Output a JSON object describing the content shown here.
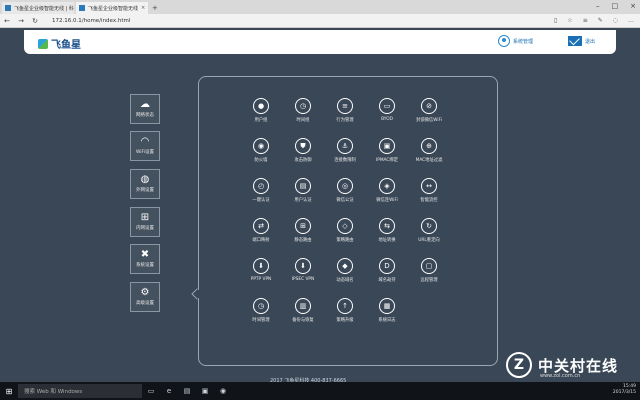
{
  "browser": {
    "tabs": [
      {
        "label": "飞鱼星企业级智能无线 | 科",
        "active": false
      },
      {
        "label": "飞鱼星企业级智能无线",
        "active": true
      }
    ],
    "url": "172.16.0.1/home/index.html"
  },
  "header": {
    "logo": "飞鱼星",
    "user_label": "系统管理",
    "logout_label": "退出"
  },
  "sidebar": [
    {
      "label": "网络状态",
      "icon": "cloud-icon"
    },
    {
      "label": "WiFi设置",
      "icon": "wifi-icon"
    },
    {
      "label": "外网设置",
      "icon": "globe-icon"
    },
    {
      "label": "内网设置",
      "icon": "network-icon"
    },
    {
      "label": "系统设置",
      "icon": "tools-icon"
    },
    {
      "label": "高级设置",
      "icon": "gears-icon"
    }
  ],
  "grid": [
    {
      "label": "用户组",
      "icon": "user-icon",
      "glyph": "●"
    },
    {
      "label": "时间组",
      "icon": "clock-icon",
      "glyph": "◷"
    },
    {
      "label": "行为管理",
      "icon": "toggle-icon",
      "glyph": "≡"
    },
    {
      "label": "BYOD",
      "icon": "devices-icon",
      "glyph": "▭"
    },
    {
      "label": "封锁微信WiFi",
      "icon": "block-icon",
      "glyph": "⊘"
    },
    {
      "label": "防火墙",
      "icon": "firewall-icon",
      "glyph": "◉"
    },
    {
      "label": "攻击防御",
      "icon": "shield-icon",
      "glyph": "⛊"
    },
    {
      "label": "连接数限制",
      "icon": "connections-icon",
      "glyph": "⚓"
    },
    {
      "label": "IPMAC绑定",
      "icon": "bind-icon",
      "glyph": "▣"
    },
    {
      "label": "MAC地址过滤",
      "icon": "filter-icon",
      "glyph": "⊕"
    },
    {
      "label": "一键认证",
      "icon": "auth-icon",
      "glyph": "◴"
    },
    {
      "label": "用户认证",
      "icon": "id-card-icon",
      "glyph": "▤"
    },
    {
      "label": "微信公证",
      "icon": "wechat-icon",
      "glyph": "◎"
    },
    {
      "label": "微信连WiFi",
      "icon": "wechat-wifi-icon",
      "glyph": "◈"
    },
    {
      "label": "智能流控",
      "icon": "flow-icon",
      "glyph": "↔"
    },
    {
      "label": "端口映射",
      "icon": "port-map-icon",
      "glyph": "⇄"
    },
    {
      "label": "静态路由",
      "icon": "static-route-icon",
      "glyph": "⊞"
    },
    {
      "label": "策略路由",
      "icon": "policy-route-icon",
      "glyph": "◇"
    },
    {
      "label": "地址转换",
      "icon": "nat-icon",
      "glyph": "⇆"
    },
    {
      "label": "URL重定向",
      "icon": "url-redirect-icon",
      "glyph": "↻"
    },
    {
      "label": "PPTP VPN",
      "icon": "pptp-vpn-icon",
      "glyph": "⬇"
    },
    {
      "label": "IPSEC VPN",
      "icon": "ipsec-vpn-icon",
      "glyph": "⬇"
    },
    {
      "label": "动态域名",
      "icon": "ddns-icon",
      "glyph": "◆"
    },
    {
      "label": "域名劫持",
      "icon": "dns-icon",
      "glyph": "D"
    },
    {
      "label": "远程管理",
      "icon": "remote-icon",
      "glyph": "▢"
    },
    {
      "label": "时间管理",
      "icon": "time-icon",
      "glyph": "◷"
    },
    {
      "label": "备份与恢复",
      "icon": "backup-icon",
      "glyph": "▥"
    },
    {
      "label": "策略升级",
      "icon": "upgrade-icon",
      "glyph": "↑"
    },
    {
      "label": "系统日志",
      "icon": "log-icon",
      "glyph": "▦"
    }
  ],
  "footer": "2017 飞鱼星科技 400-837-6665",
  "watermark": {
    "text": "中关村在线",
    "url": "www.zol.com.cn"
  },
  "taskbar": {
    "search_placeholder": "搜索 Web 和 Windows",
    "time": "15:49",
    "date": "2017/3/15"
  },
  "colors": {
    "background": "#3a4756",
    "accent": "#1a6fb5"
  }
}
